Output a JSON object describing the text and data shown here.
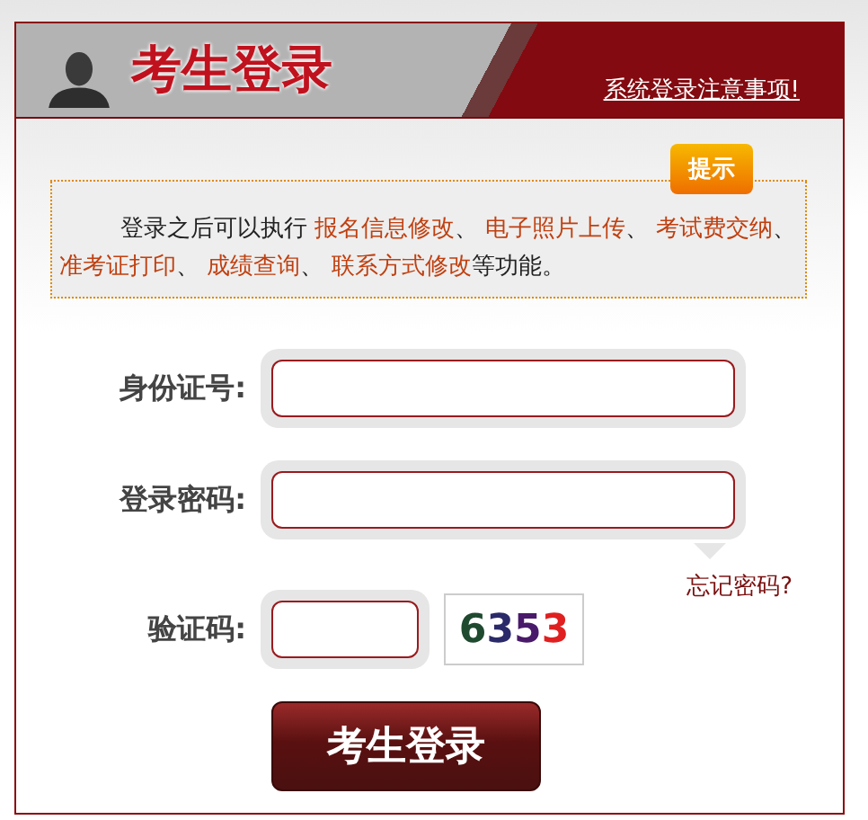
{
  "header": {
    "title": "考生登录",
    "notice_link": "系统登录注意事项!"
  },
  "tip": {
    "badge": "提示",
    "parts": [
      {
        "text": "登录之后可以执行 ",
        "kind": "plain"
      },
      {
        "text": "报名信息修改",
        "kind": "link"
      },
      {
        "text": "、 ",
        "kind": "plain"
      },
      {
        "text": "电子照片上传",
        "kind": "link"
      },
      {
        "text": "、 ",
        "kind": "plain"
      },
      {
        "text": "考试费交纳",
        "kind": "link"
      },
      {
        "text": "、 ",
        "kind": "plain"
      },
      {
        "text": "准考证打印",
        "kind": "link"
      },
      {
        "text": "、 ",
        "kind": "plain"
      },
      {
        "text": "成绩查询",
        "kind": "link"
      },
      {
        "text": "、 ",
        "kind": "plain"
      },
      {
        "text": "联系方式修改",
        "kind": "link"
      },
      {
        "text": "等功能。",
        "kind": "plain"
      }
    ]
  },
  "fields": [
    {
      "label": "身份证号:",
      "kind": "wide"
    },
    {
      "label": "登录密码:",
      "kind": "wide"
    },
    {
      "label": "验证码:",
      "kind": "captcha"
    }
  ],
  "forgot_link": "忘记密码?",
  "captcha": [
    {
      "text": "6",
      "color": "#1f4a30"
    },
    {
      "text": "3",
      "color": "#2a2a6a"
    },
    {
      "text": "5",
      "color": "#4a1a6a"
    },
    {
      "text": "3",
      "color": "#e02020"
    }
  ],
  "submit": "考生登录"
}
